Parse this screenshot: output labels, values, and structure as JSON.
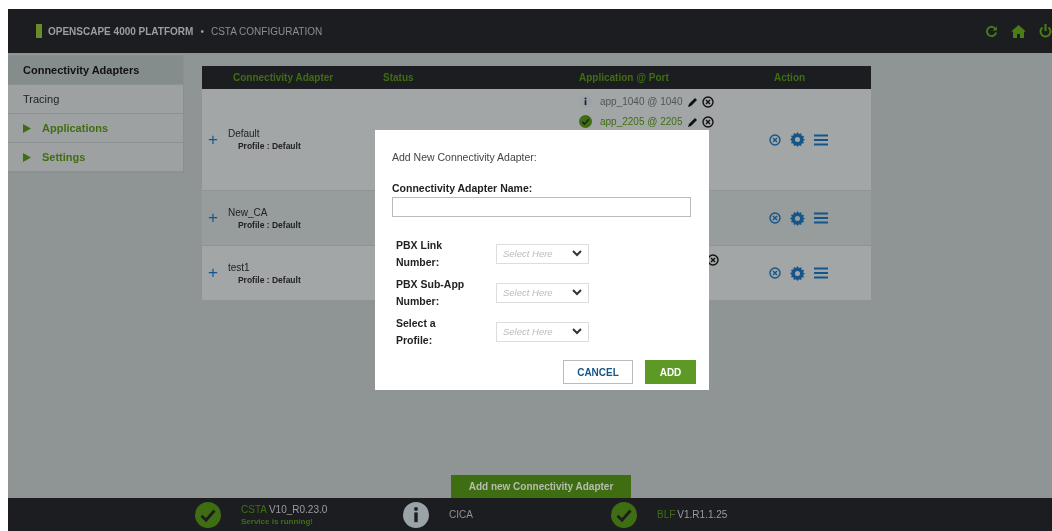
{
  "top_bar": {
    "brand": "OPENSCAPE 4000 PLATFORM",
    "separator": "•",
    "page": "CSTA CONFIGURATION"
  },
  "sidebar": {
    "items": [
      {
        "label": "Connectivity Adapters",
        "kind": "link",
        "selected": true
      },
      {
        "label": "Tracing",
        "kind": "link",
        "selected": false
      },
      {
        "label": "Applications",
        "kind": "group",
        "selected": false,
        "expanded": false
      },
      {
        "label": "Settings",
        "kind": "group",
        "selected": false,
        "expanded": false
      }
    ]
  },
  "table": {
    "columns": [
      "Connectivity Adapter",
      "Status",
      "Application @ Port",
      "Action"
    ],
    "rows": [
      {
        "toggle": "+",
        "name": "Default",
        "profile": "Profile : Default",
        "apps": [
          {
            "label": "app_1040 @ 1040",
            "kind": "info",
            "removable": true
          },
          {
            "label": "app_2205 @ 2205",
            "kind": "ok",
            "removable": true
          }
        ]
      },
      {
        "toggle": "+",
        "name": "New_CA",
        "profile": "Profile : Default",
        "apps": []
      },
      {
        "toggle": "+",
        "name": "test1",
        "profile": "Profile : Default",
        "apps": [
          {
            "removable": true
          }
        ]
      }
    ]
  },
  "add_button": "Add new Connectivity Adapter",
  "dialog": {
    "title": "Add New Connectivity Adapter:",
    "name_label": "Connectivity Adapter Name:",
    "selects": [
      {
        "label": "PBX Link Number:",
        "placeholder": "Select Here"
      },
      {
        "label": "PBX Sub-App Number:",
        "placeholder": "Select Here"
      },
      {
        "label": "Select a Profile:",
        "placeholder": "Select Here"
      }
    ],
    "buttons": [
      {
        "label": "CANCEL",
        "kind": "secondary"
      },
      {
        "label": "ADD",
        "kind": "primary"
      }
    ]
  },
  "status_bar": [
    {
      "name": "CSTA",
      "version": "V10_R0.23.0",
      "message": "Service is running!",
      "kind": "ok"
    },
    {
      "name": "CICA",
      "kind": "info"
    },
    {
      "name": "BLF",
      "version": "V1.R1.1.25",
      "kind": "ok"
    }
  ]
}
